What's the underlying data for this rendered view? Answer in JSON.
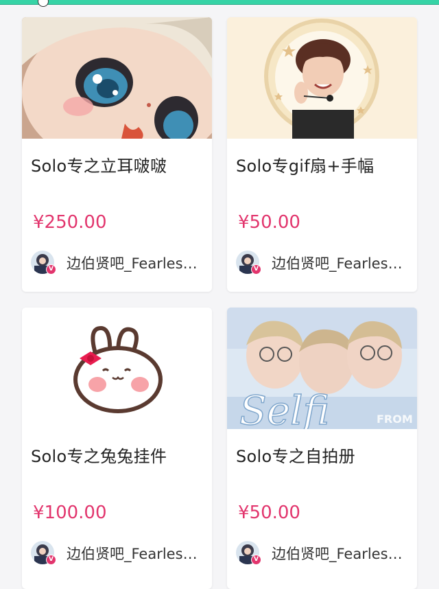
{
  "colors": {
    "accent_bar": "#36d3a6",
    "price": "#e2356d",
    "verified_badge": "#e2356d"
  },
  "products": [
    {
      "title": "Solo专之立耳啵啵",
      "price": "¥250.00",
      "seller": "边伯贤吧_Fearless...",
      "thumbnail_icon": "plush-doll-photo",
      "verified_mark": "V"
    },
    {
      "title": "Solo专gif扇+手幅",
      "price": "¥50.00",
      "seller": "边伯贤吧_Fearless...",
      "thumbnail_icon": "portrait-fan-photo",
      "verified_mark": "V"
    },
    {
      "title": "Solo专之兔兔挂件",
      "price": "¥100.00",
      "seller": "边伯贤吧_Fearless...",
      "thumbnail_icon": "bunny-charm-illustration",
      "verified_mark": "V"
    },
    {
      "title": "Solo专之自拍册",
      "price": "¥50.00",
      "seller": "边伯贤吧_Fearless...",
      "thumbnail_icon": "selfie-book-cover",
      "thumbnail_text": "Selfi",
      "thumbnail_subtext": "FROM",
      "verified_mark": "V"
    }
  ]
}
